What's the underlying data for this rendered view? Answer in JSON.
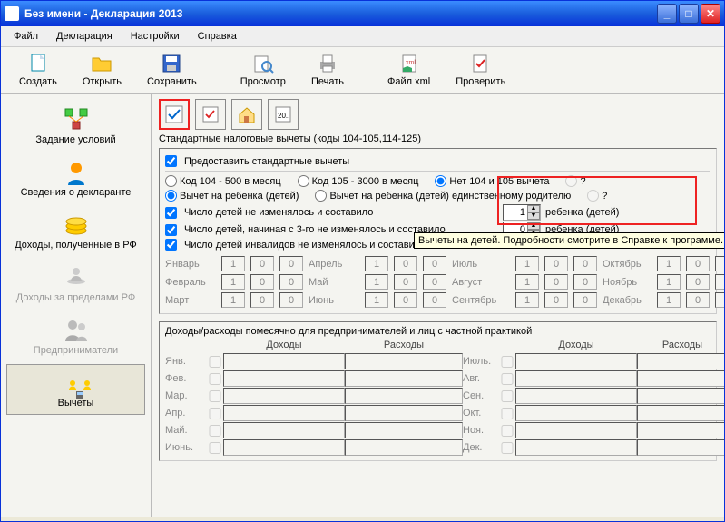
{
  "window": {
    "title": "Без имени - Декларация 2013"
  },
  "menu": {
    "file": "Файл",
    "decl": "Декларация",
    "settings": "Настройки",
    "help": "Справка"
  },
  "toolbar": {
    "create": "Создать",
    "open": "Открыть",
    "save": "Сохранить",
    "preview": "Просмотр",
    "print": "Печать",
    "xml": "Файл xml",
    "check": "Проверить"
  },
  "sidebar": {
    "cond": "Задание условий",
    "decl": "Сведения о декларанте",
    "income": "Доходы, полученные в РФ",
    "abroad": "Доходы за пределами РФ",
    "entr": "Предприниматели",
    "deduct": "Вычеты"
  },
  "tabs": {
    "t20": "20.."
  },
  "section": {
    "title": "Стандартные налоговые вычеты (коды 104-105,114-125)",
    "provide": "Предоставить стандартные вычеты",
    "r1": "Код 104 - 500 в месяц",
    "r2": "Код 105 - 3000 в месяц",
    "r3": "Нет 104 и 105 вычета",
    "q": "?",
    "child1": "Вычет на ребенка (детей)",
    "child2": "Вычет на ребенка (детей) единственному родителю",
    "c1": "Число детей не изменялось и составило",
    "c2": "Число детей, начиная с 3-го не изменялось и составило",
    "c3": "Число детей инвалидов не изменялось и составило",
    "unit": "ребенка (детей)",
    "spin1": "1",
    "spin2": "0",
    "tooltip": "Вычеты на детей. Подробности смотрите в Справке к программе."
  },
  "months": {
    "m1": "Январь",
    "m2": "Февраль",
    "m3": "Март",
    "m4": "Апрель",
    "m5": "Май",
    "m6": "Июнь",
    "m7": "Июль",
    "m8": "Август",
    "m9": "Сентябрь",
    "m10": "Октябрь",
    "m11": "Ноябрь",
    "m12": "Декабрь",
    "v1": "1",
    "v0": "0"
  },
  "income": {
    "title": "Доходы/расходы помесячно для предпринимателей и лиц с частной практикой",
    "h_income": "Доходы",
    "h_expense": "Расходы",
    "r1": "Янв.",
    "r2": "Фев.",
    "r3": "Мар.",
    "r4": "Апр.",
    "r5": "Май.",
    "r6": "Июнь.",
    "r7": "Июль.",
    "r8": "Авг.",
    "r9": "Сен.",
    "r10": "Окт.",
    "r11": "Ноя.",
    "r12": "Дек."
  }
}
